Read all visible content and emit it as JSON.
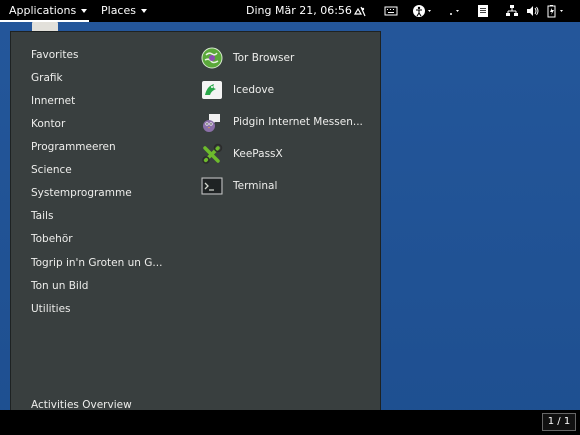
{
  "topbar": {
    "applications_label": "Applications",
    "places_label": "Places",
    "clock": "Ding Mär 21, 06:56",
    "accessibility_caret_visible": true
  },
  "menu": {
    "categories": [
      "Favorites",
      "Grafik",
      "Innernet",
      "Kontor",
      "Programmeeren",
      "Science",
      "Systemprogramme",
      "Tails",
      "Tobehör",
      "Togrip in'n Groten un G...",
      "Ton un Bild",
      "Utilities"
    ],
    "activities_overview": "Activities Overview",
    "apps": [
      {
        "label": "Tor Browser",
        "icon": "tor-browser-icon"
      },
      {
        "label": "Icedove",
        "icon": "icedove-icon"
      },
      {
        "label": "Pidgin Internet Messen...",
        "icon": "pidgin-icon"
      },
      {
        "label": "KeePassX",
        "icon": "keepassx-icon"
      },
      {
        "label": "Terminal",
        "icon": "terminal-icon"
      }
    ]
  },
  "bottombar": {
    "workspace": "1 / 1"
  },
  "colors": {
    "desktop": "#1e4f90",
    "panel": "#000000",
    "menu_bg": "#393f3f",
    "menu_text": "#eeeeec"
  }
}
